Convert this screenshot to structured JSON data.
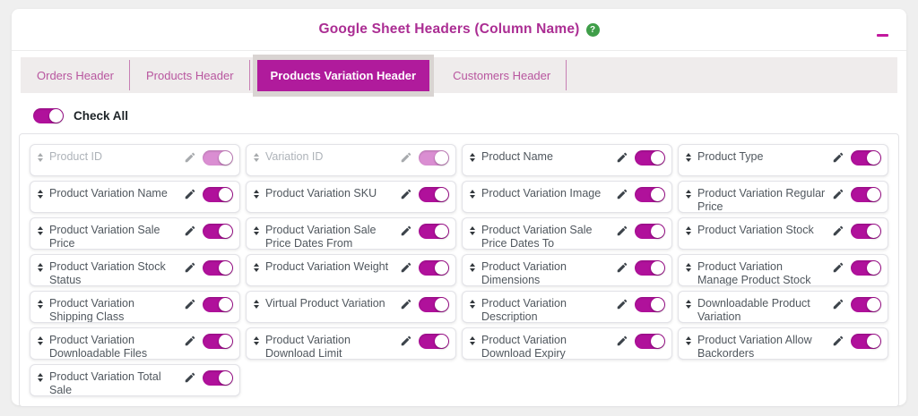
{
  "panel": {
    "title": "Google Sheet Headers (Column Name)",
    "help_icon": "?",
    "collapse_icon": "minus"
  },
  "tabs": [
    {
      "label": "Orders Header",
      "active": false
    },
    {
      "label": "Products Header",
      "active": false
    },
    {
      "label": "Products Variation Header",
      "active": true
    },
    {
      "label": "Customers Header",
      "active": false
    }
  ],
  "check_all": {
    "label": "Check All",
    "checked": true
  },
  "colors": {
    "accent": "#b0119b",
    "accent_disabled": "#da8ed2",
    "title_text": "#ab2d93",
    "tab_text": "#b8569f",
    "active_tab_bg": "#b01b9c",
    "help_green": "#3f9e49",
    "page_bg": "#efefef"
  },
  "headers_grid": {
    "items": [
      {
        "label": "Product ID",
        "checked": true,
        "disabled": true
      },
      {
        "label": "Variation ID",
        "checked": true,
        "disabled": true
      },
      {
        "label": "Product Name",
        "checked": true,
        "disabled": false
      },
      {
        "label": "Product Type",
        "checked": true,
        "disabled": false
      },
      {
        "label": "Product Variation Name",
        "checked": true,
        "disabled": false
      },
      {
        "label": "Product Variation SKU",
        "checked": true,
        "disabled": false
      },
      {
        "label": "Product Variation Image",
        "checked": true,
        "disabled": false
      },
      {
        "label": "Product Variation Regular Price",
        "checked": true,
        "disabled": false
      },
      {
        "label": "Product Variation Sale Price",
        "checked": true,
        "disabled": false
      },
      {
        "label": "Product Variation Sale Price Dates From",
        "checked": true,
        "disabled": false
      },
      {
        "label": "Product Variation Sale Price Dates To",
        "checked": true,
        "disabled": false
      },
      {
        "label": "Product Variation Stock",
        "checked": true,
        "disabled": false
      },
      {
        "label": "Product Variation Stock Status",
        "checked": true,
        "disabled": false
      },
      {
        "label": "Product Variation Weight",
        "checked": true,
        "disabled": false
      },
      {
        "label": "Product Variation Dimensions",
        "checked": true,
        "disabled": false
      },
      {
        "label": "Product Variation Manage Product Stock",
        "checked": true,
        "disabled": false
      },
      {
        "label": "Product Variation Shipping Class",
        "checked": true,
        "disabled": false
      },
      {
        "label": "Virtual Product Variation",
        "checked": true,
        "disabled": false
      },
      {
        "label": "Product Variation Description",
        "checked": true,
        "disabled": false
      },
      {
        "label": "Downloadable Product Variation",
        "checked": true,
        "disabled": false
      },
      {
        "label": "Product Variation Downloadable Files",
        "checked": true,
        "disabled": false
      },
      {
        "label": "Product Variation Download Limit",
        "checked": true,
        "disabled": false
      },
      {
        "label": "Product Variation Download Expiry",
        "checked": true,
        "disabled": false
      },
      {
        "label": "Product Variation Allow Backorders",
        "checked": true,
        "disabled": false
      },
      {
        "label": "Product Variation Total Sale",
        "checked": true,
        "disabled": false
      }
    ]
  }
}
